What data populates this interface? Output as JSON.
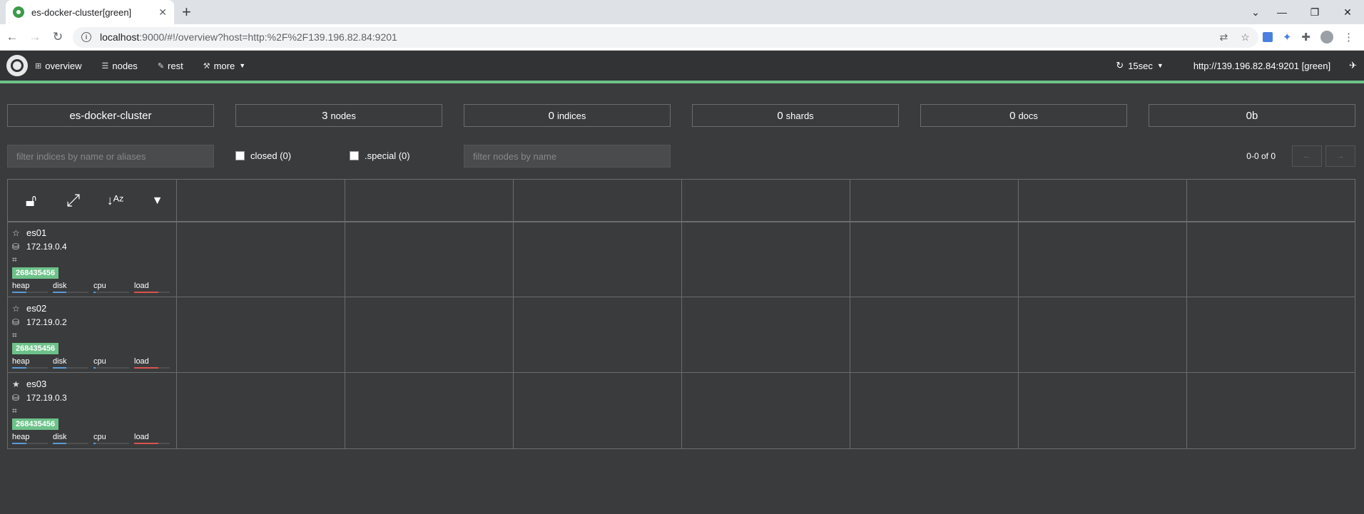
{
  "browser": {
    "tab_title": "es-docker-cluster[green]",
    "url_host": "localhost",
    "url_path": ":9000/#!/overview?host=http:%2F%2F139.196.82.84:9201"
  },
  "nav": {
    "overview": "overview",
    "nodes": "nodes",
    "rest": "rest",
    "more": "more",
    "refresh": "15sec",
    "host": "http://139.196.82.84:9201 [green]"
  },
  "stats": {
    "cluster": "es-docker-cluster",
    "nodes_num": "3",
    "nodes_label": "nodes",
    "indices_num": "0",
    "indices_label": "indices",
    "shards_num": "0",
    "shards_label": "shards",
    "docs_num": "0",
    "docs_label": "docs",
    "size": "0b"
  },
  "filters": {
    "indices_placeholder": "filter indices by name or aliases",
    "closed": "closed (0)",
    "special": ".special (0)",
    "nodes_placeholder": "filter nodes by name",
    "pager": "0-0 of 0",
    "prev": "←",
    "next": "→"
  },
  "meter_labels": {
    "heap": "heap",
    "disk": "disk",
    "cpu": "cpu",
    "load": "load"
  },
  "colors": {
    "green": "#6dc28a",
    "blue": "#5b9bd5",
    "red": "#d9534f"
  },
  "nodes": [
    {
      "name": "es01",
      "ip": "172.19.0.4",
      "heap_bytes": "268435456",
      "master": false,
      "heap": 0.4,
      "disk": 0.38,
      "cpu": 0.05,
      "load": 0.68
    },
    {
      "name": "es02",
      "ip": "172.19.0.2",
      "heap_bytes": "268435456",
      "master": false,
      "heap": 0.4,
      "disk": 0.38,
      "cpu": 0.05,
      "load": 0.68
    },
    {
      "name": "es03",
      "ip": "172.19.0.3",
      "heap_bytes": "268435456",
      "master": true,
      "heap": 0.4,
      "disk": 0.38,
      "cpu": 0.05,
      "load": 0.68
    }
  ]
}
